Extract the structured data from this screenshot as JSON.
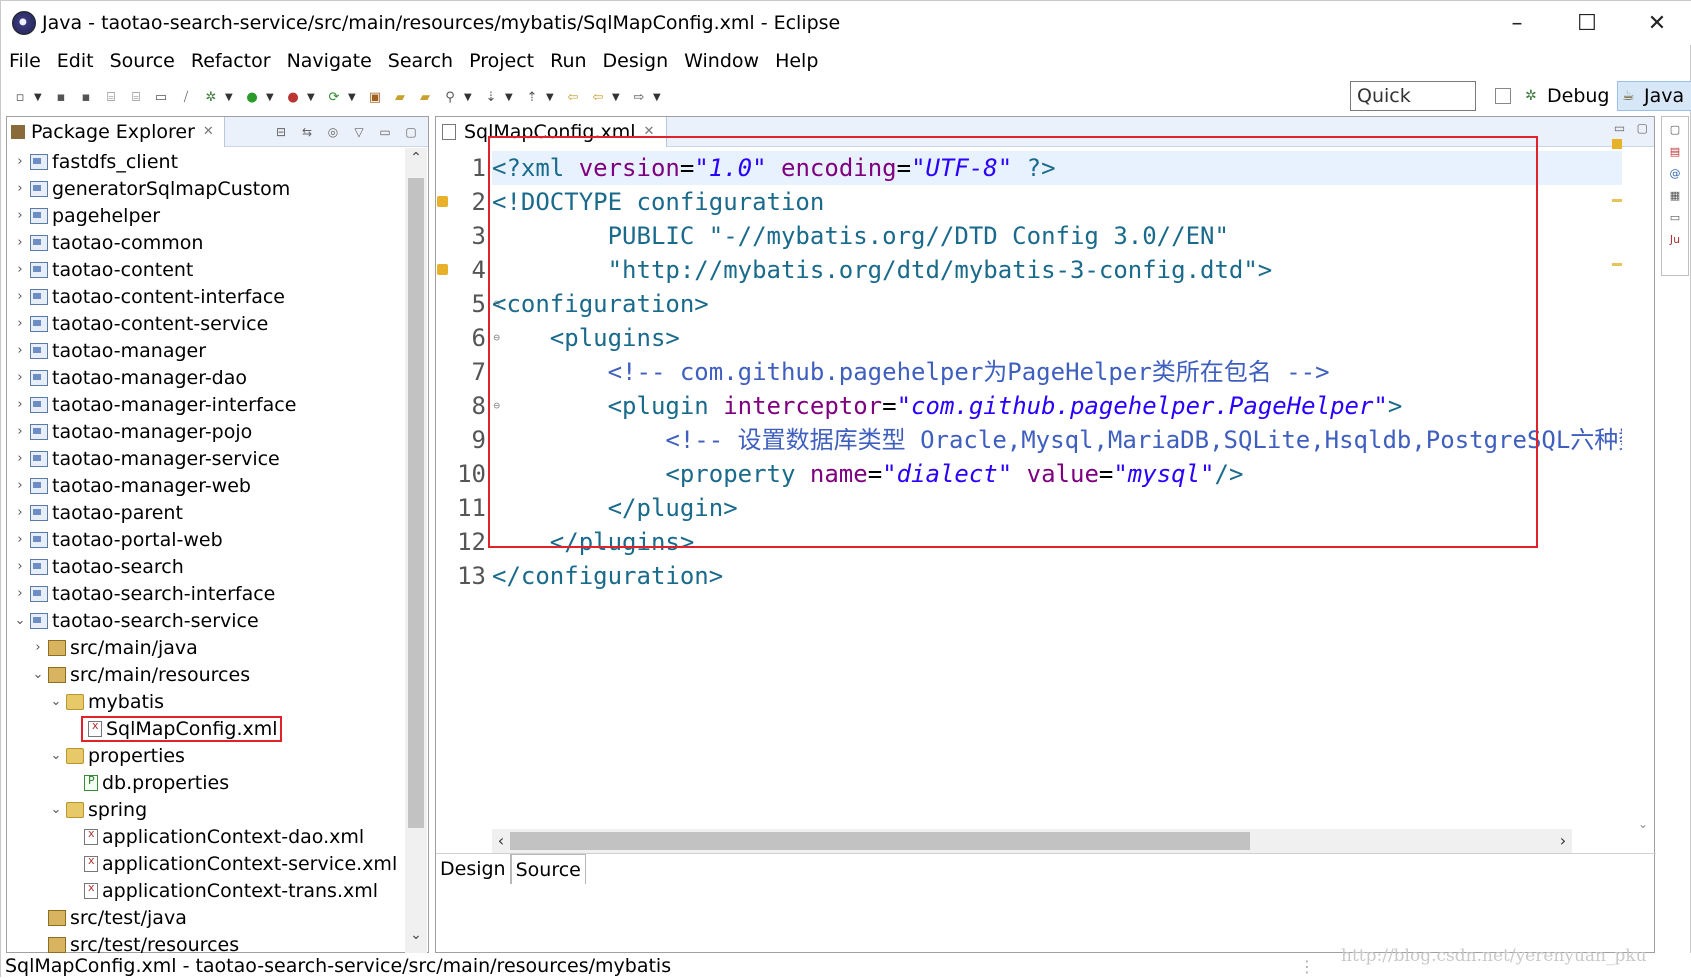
{
  "window": {
    "title": "Java - taotao-search-service/src/main/resources/mybatis/SqlMapConfig.xml - Eclipse",
    "controls": [
      "–",
      "☐",
      "✕"
    ]
  },
  "menu": [
    "File",
    "Edit",
    "Source",
    "Refactor",
    "Navigate",
    "Search",
    "Project",
    "Run",
    "Design",
    "Window",
    "Help"
  ],
  "toolbar": {
    "quick_access": "Quick Access",
    "perspectives": {
      "debug": "Debug",
      "java": "Java"
    }
  },
  "package_explorer": {
    "title": "Package Explorer",
    "items": [
      {
        "label": "fastdfs_client",
        "depth": 0,
        "chevron": "›",
        "icon": "proj"
      },
      {
        "label": "generatorSqlmapCustom",
        "depth": 0,
        "chevron": "›",
        "icon": "proj"
      },
      {
        "label": "pagehelper",
        "depth": 0,
        "chevron": "›",
        "icon": "proj"
      },
      {
        "label": "taotao-common",
        "depth": 0,
        "chevron": "›",
        "icon": "proj"
      },
      {
        "label": "taotao-content",
        "depth": 0,
        "chevron": "›",
        "icon": "proj"
      },
      {
        "label": "taotao-content-interface",
        "depth": 0,
        "chevron": "›",
        "icon": "proj"
      },
      {
        "label": "taotao-content-service",
        "depth": 0,
        "chevron": "›",
        "icon": "proj"
      },
      {
        "label": "taotao-manager",
        "depth": 0,
        "chevron": "›",
        "icon": "proj"
      },
      {
        "label": "taotao-manager-dao",
        "depth": 0,
        "chevron": "›",
        "icon": "proj"
      },
      {
        "label": "taotao-manager-interface",
        "depth": 0,
        "chevron": "›",
        "icon": "proj"
      },
      {
        "label": "taotao-manager-pojo",
        "depth": 0,
        "chevron": "›",
        "icon": "proj"
      },
      {
        "label": "taotao-manager-service",
        "depth": 0,
        "chevron": "›",
        "icon": "proj"
      },
      {
        "label": "taotao-manager-web",
        "depth": 0,
        "chevron": "›",
        "icon": "proj"
      },
      {
        "label": "taotao-parent",
        "depth": 0,
        "chevron": "›",
        "icon": "proj"
      },
      {
        "label": "taotao-portal-web",
        "depth": 0,
        "chevron": "›",
        "icon": "proj"
      },
      {
        "label": "taotao-search",
        "depth": 0,
        "chevron": "›",
        "icon": "proj"
      },
      {
        "label": "taotao-search-interface",
        "depth": 0,
        "chevron": "›",
        "icon": "proj"
      },
      {
        "label": "taotao-search-service",
        "depth": 0,
        "chevron": "⌄",
        "icon": "proj"
      },
      {
        "label": "src/main/java",
        "depth": 1,
        "chevron": "›",
        "icon": "src"
      },
      {
        "label": "src/main/resources",
        "depth": 1,
        "chevron": "⌄",
        "icon": "src"
      },
      {
        "label": "mybatis",
        "depth": 2,
        "chevron": "⌄",
        "icon": "folder"
      },
      {
        "label": "SqlMapConfig.xml",
        "depth": 3,
        "chevron": "",
        "icon": "xml",
        "highlighted": true
      },
      {
        "label": "properties",
        "depth": 2,
        "chevron": "⌄",
        "icon": "folder"
      },
      {
        "label": "db.properties",
        "depth": 3,
        "chevron": "",
        "icon": "prop"
      },
      {
        "label": "spring",
        "depth": 2,
        "chevron": "⌄",
        "icon": "folder"
      },
      {
        "label": "applicationContext-dao.xml",
        "depth": 3,
        "chevron": "",
        "icon": "xml"
      },
      {
        "label": "applicationContext-service.xml",
        "depth": 3,
        "chevron": "",
        "icon": "xml"
      },
      {
        "label": "applicationContext-trans.xml",
        "depth": 3,
        "chevron": "",
        "icon": "xml"
      },
      {
        "label": "src/test/java",
        "depth": 1,
        "chevron": "",
        "icon": "src"
      },
      {
        "label": "src/test/resources",
        "depth": 1,
        "chevron": "",
        "icon": "src"
      }
    ]
  },
  "editor": {
    "tab_label": "SqlMapConfig.xml",
    "line_numbers": [
      "1",
      "2",
      "3",
      "4",
      "5",
      "6",
      "7",
      "8",
      "9",
      "10",
      "11",
      "12",
      "13"
    ],
    "lines": [
      [
        [
          "c-pi",
          "<?xml "
        ],
        [
          "c-attr",
          "version"
        ],
        [
          "c-black",
          "="
        ],
        [
          "c-val",
          "\"1.0\""
        ],
        [
          "c-black",
          " "
        ],
        [
          "c-attr",
          "encoding"
        ],
        [
          "c-black",
          "="
        ],
        [
          "c-val",
          "\"UTF-8\""
        ],
        [
          "c-black",
          " "
        ],
        [
          "c-pi",
          "?>"
        ]
      ],
      [
        [
          "c-dt",
          "<!DOCTYPE configuration"
        ]
      ],
      [
        [
          "c-black",
          "        "
        ],
        [
          "c-str",
          "PUBLIC \"-//mybatis.org//DTD Config 3.0//EN\""
        ]
      ],
      [
        [
          "c-black",
          "        "
        ],
        [
          "c-str",
          "\"http://mybatis.org/dtd/mybatis-3-config.dtd\">"
        ]
      ],
      [
        [
          "c-tag",
          "<configuration>"
        ]
      ],
      [
        [
          "c-black",
          "    "
        ],
        [
          "c-tag",
          "<plugins>"
        ]
      ],
      [
        [
          "c-black",
          "        "
        ],
        [
          "c-cmt",
          "<!-- com.github.pagehelper为PageHelper类所在包名 -->"
        ]
      ],
      [
        [
          "c-black",
          "        "
        ],
        [
          "c-tag",
          "<plugin "
        ],
        [
          "c-attr",
          "interceptor"
        ],
        [
          "c-black",
          "="
        ],
        [
          "c-val",
          "\"com.github.pagehelper.PageHelper\""
        ],
        [
          "c-tag",
          ">"
        ]
      ],
      [
        [
          "c-black",
          "            "
        ],
        [
          "c-cmt",
          "<!-- 设置数据库类型 Oracle,Mysql,MariaDB,SQLite,Hsqldb,PostgreSQL六种数据库-->"
        ]
      ],
      [
        [
          "c-black",
          "            "
        ],
        [
          "c-tag",
          "<property "
        ],
        [
          "c-attr",
          "name"
        ],
        [
          "c-black",
          "="
        ],
        [
          "c-val",
          "\"dialect\""
        ],
        [
          "c-black",
          " "
        ],
        [
          "c-attr",
          "value"
        ],
        [
          "c-black",
          "="
        ],
        [
          "c-val",
          "\"mysql\""
        ],
        [
          "c-tag",
          "/>"
        ]
      ],
      [
        [
          "c-black",
          "        "
        ],
        [
          "c-tag",
          "</plugin>"
        ]
      ],
      [
        [
          "c-black",
          "    "
        ],
        [
          "c-tag",
          "</plugins>"
        ]
      ],
      [
        [
          "c-tag",
          "</configuration>"
        ]
      ]
    ],
    "bottom_tabs": [
      "Design",
      "Source"
    ]
  },
  "status_bar": {
    "text": "SqlMapConfig.xml - taotao-search-service/src/main/resources/mybatis"
  },
  "watermark": "http://blog.csdn.net/yerenyuan_pku"
}
